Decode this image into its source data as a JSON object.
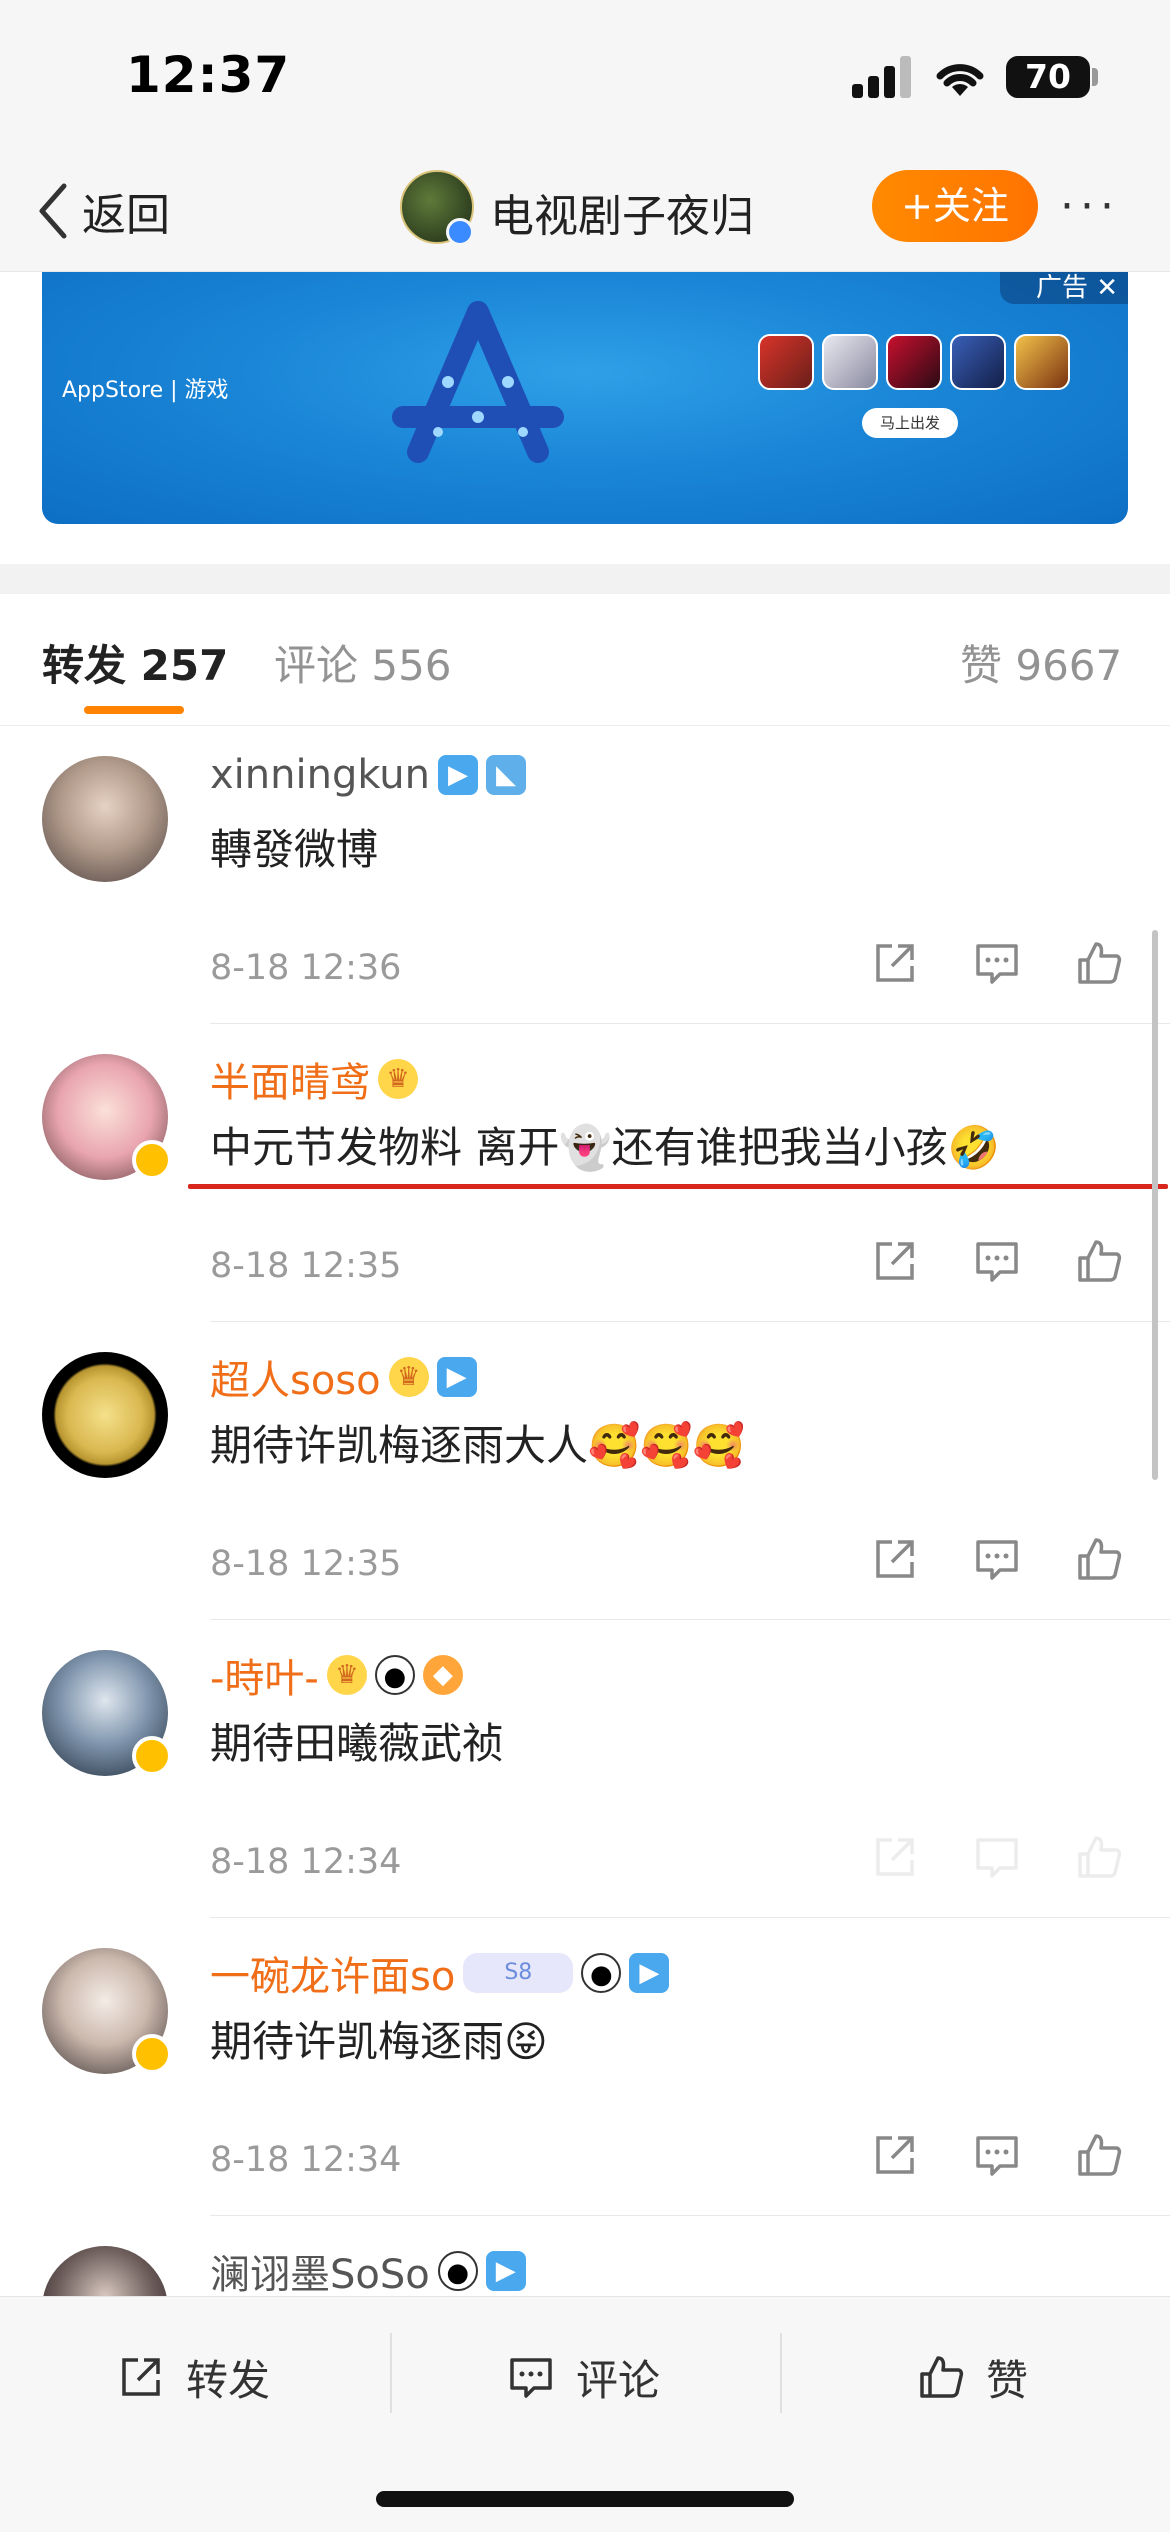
{
  "status_bar": {
    "time": "12:37",
    "battery": "70"
  },
  "nav": {
    "back_label": "返回",
    "title": "电视剧子夜归",
    "follow_label": "+关注",
    "more": "···"
  },
  "ad": {
    "store_label": "AppStore | 游戏",
    "cta": "马上出发",
    "tag": "广告 ✕"
  },
  "tabs": {
    "repost": "转发 257",
    "comment": "评论 556",
    "like": "赞 9667"
  },
  "items": [
    {
      "name": "xinningkun",
      "content": "轉發微博",
      "time": "8-18 12:36"
    },
    {
      "name": "半面晴鸢",
      "content": "中元节发物料 离开👻还有谁把我当小孩🤣",
      "time": "8-18 12:35"
    },
    {
      "name": "超人soso",
      "content": "期待许凯梅逐雨大人🥰🥰🥰",
      "time": "8-18 12:35"
    },
    {
      "name": "-時叶-",
      "content": "期待田曦薇武祯",
      "time": "8-18 12:34"
    },
    {
      "name": "一碗龙许面so",
      "pill": "S8",
      "content": "期待许凯梅逐雨😝",
      "time": "8-18 12:34"
    },
    {
      "name": "澜诩墨SoSo",
      "content": "",
      "time": ""
    }
  ],
  "bottom_bar": {
    "repost": "转发",
    "comment": "评论",
    "like": "赞"
  },
  "colors": {
    "accent": "#ff8200",
    "vip_name": "#f06e18",
    "highlight_line": "#d9261c"
  }
}
